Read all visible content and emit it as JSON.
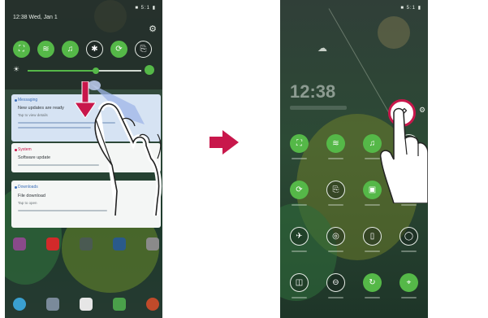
{
  "status_bar": {
    "text": "■ 5:1 ▮"
  },
  "left_phone": {
    "time": "12:38 Wed, Jan 1",
    "gear_icon": "gear-icon",
    "quick_tiles": [
      {
        "icon": "screen-fit-icon",
        "on": true
      },
      {
        "icon": "wifi-icon",
        "on": true
      },
      {
        "icon": "sound-icon",
        "on": true
      },
      {
        "icon": "bluetooth-icon",
        "on": false
      },
      {
        "icon": "rotate-icon",
        "on": true
      },
      {
        "icon": "nfc-icon",
        "on": false
      }
    ],
    "brightness_level": 0.6,
    "notifications": [
      {
        "app": "Messaging",
        "title": "New updates are ready",
        "text": "Tap to view details"
      },
      {
        "app": "System",
        "title": "Software update",
        "text": ""
      },
      {
        "app": "Downloads",
        "title": "File download",
        "text": "Tap to open"
      }
    ]
  },
  "right_phone": {
    "time": "12:38",
    "edit_icon": "pencil-icon",
    "tiles": [
      {
        "icon": "screen-fit-icon",
        "on": true
      },
      {
        "icon": "wifi-icon",
        "on": true
      },
      {
        "icon": "sound-icon",
        "on": true
      },
      {
        "icon": "bluetooth-icon",
        "on": false
      },
      {
        "icon": "rotate-icon",
        "on": true
      },
      {
        "icon": "nfc-icon",
        "on": false
      },
      {
        "icon": "tag-icon",
        "on": true
      },
      {
        "icon": "flashlight-icon",
        "on": false
      },
      {
        "icon": "airplane-icon",
        "on": false
      },
      {
        "icon": "hotspot-icon",
        "on": false
      },
      {
        "icon": "battery-icon",
        "on": false
      },
      {
        "icon": "sync-icon",
        "on": false
      },
      {
        "icon": "dual-window-icon",
        "on": false
      },
      {
        "icon": "do-not-disturb-icon",
        "on": false
      },
      {
        "icon": "refresh-icon",
        "on": true
      },
      {
        "icon": "location-icon",
        "on": true
      }
    ]
  },
  "colors": {
    "accent_green": "#55b848",
    "arrow": "#c8174b",
    "notif_blue": "#3c6fb8"
  }
}
